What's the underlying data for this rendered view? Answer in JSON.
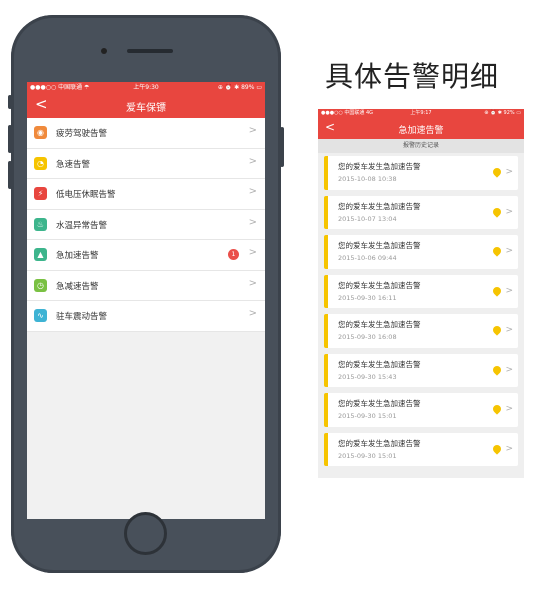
{
  "phone": {
    "statusbar": {
      "carrier": "●●●○○ 中国联通 ☂",
      "time": "上午9:30",
      "right": "⊕ ⏰ ✱ 89% ▭"
    },
    "nav": {
      "back": "<",
      "title": "爱车保镖"
    },
    "menu": [
      {
        "label": "疲劳驾驶告警",
        "icon": "fatigue-driving-icon",
        "color": "#f08a3c",
        "glyph": "◉"
      },
      {
        "label": "急速告警",
        "icon": "speed-gauge-icon",
        "color": "#f6c400",
        "glyph": "◔"
      },
      {
        "label": "低电压休眠告警",
        "icon": "low-voltage-icon",
        "color": "#e8463f",
        "glyph": "⚡"
      },
      {
        "label": "水温异常告警",
        "icon": "water-temperature-icon",
        "color": "#3db58c",
        "glyph": "♨"
      },
      {
        "label": "急加速告警",
        "icon": "acceleration-icon",
        "color": "#3db58c",
        "glyph": "▲",
        "badge": "1"
      },
      {
        "label": "急减速告警",
        "icon": "deceleration-icon",
        "color": "#7ac143",
        "glyph": "◷"
      },
      {
        "label": "驻车震动告警",
        "icon": "parking-vibration-icon",
        "color": "#3eb3d4",
        "glyph": "∿"
      }
    ],
    "arrow": ">"
  },
  "heading": "具体告警明细",
  "detail": {
    "statusbar": {
      "carrier": "●●●○○ 中国联通 4G",
      "time": "上午9:17",
      "right": "⊕ ⏰ ✱ 92% ▭"
    },
    "nav": {
      "back": "<",
      "title": "急加速告警"
    },
    "subheader": "报警历史记录",
    "alerts": [
      {
        "message": "您的爱车发生急加速告警",
        "time": "2015-10-08 10:38"
      },
      {
        "message": "您的爱车发生急加速告警",
        "time": "2015-10-07 13:04"
      },
      {
        "message": "您的爱车发生急加速告警",
        "time": "2015-10-06 09:44"
      },
      {
        "message": "您的爱车发生急加速告警",
        "time": "2015-09-30 16:11"
      },
      {
        "message": "您的爱车发生急加速告警",
        "time": "2015-09-30 16:08"
      },
      {
        "message": "您的爱车发生急加速告警",
        "time": "2015-09-30 15:43"
      },
      {
        "message": "您的爱车发生急加速告警",
        "time": "2015-09-30 15:01"
      },
      {
        "message": "您的爱车发生急加速告警",
        "time": "2015-09-30 15:01"
      }
    ],
    "arrow": ">",
    "accent": "#f6c400"
  },
  "colors": {
    "brand_red": "#e8463f",
    "badge_red": "#ea4f4a"
  }
}
